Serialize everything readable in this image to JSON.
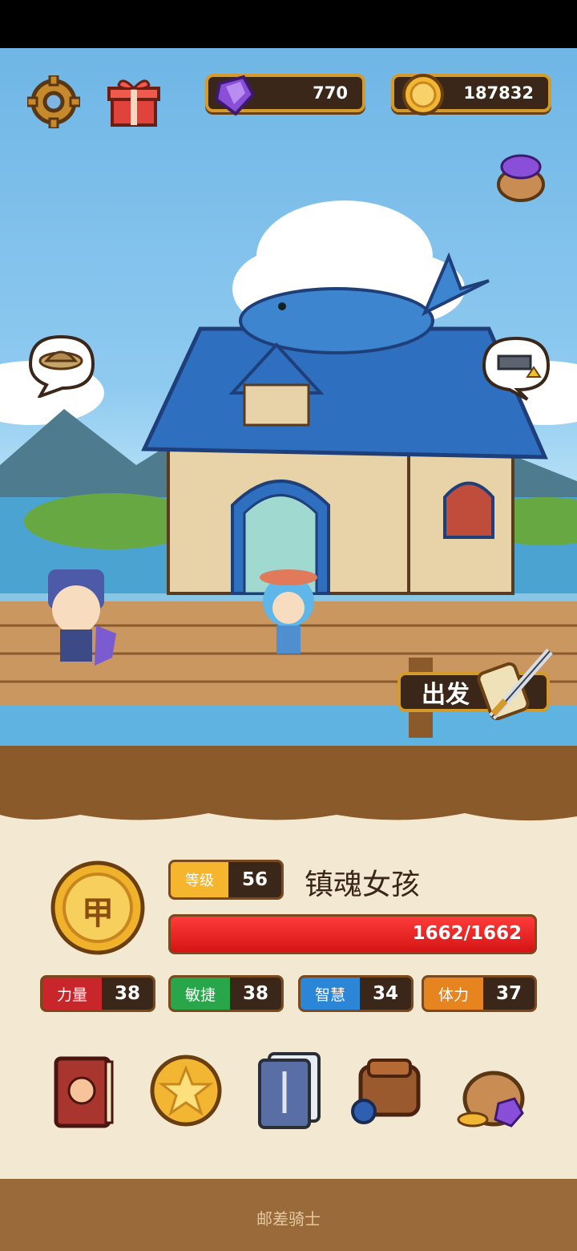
{
  "hud": {
    "gems": "770",
    "coins": "187832"
  },
  "depart_button": {
    "label": "出发"
  },
  "character": {
    "level_label": "等级",
    "level": "56",
    "name": "镇魂女孩",
    "hp": "1662/1662",
    "hp_fraction": 1.0,
    "rank_emblem": "甲"
  },
  "stats": [
    {
      "label": "力量",
      "value": "38",
      "color": "#c8262b"
    },
    {
      "label": "敏捷",
      "value": "38",
      "color": "#2aa64a"
    },
    {
      "label": "智慧",
      "value": "34",
      "color": "#2c86d8"
    },
    {
      "label": "体力",
      "value": "37",
      "color": "#e6851f"
    }
  ],
  "menu_icons": [
    "book-icon",
    "star-coin-icon",
    "card-deck-icon",
    "backpack-icon",
    "treasure-bag-icon"
  ],
  "footer": {
    "title": "邮差骑士"
  }
}
